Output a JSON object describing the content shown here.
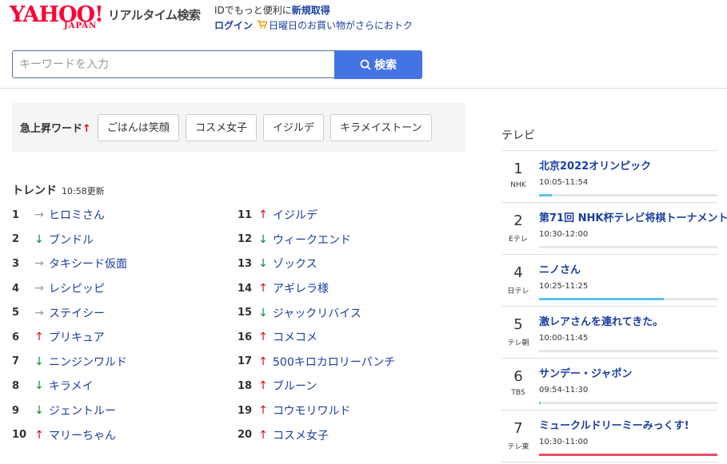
{
  "header": {
    "logo_text": "YAHOO!",
    "logo_sub": "JAPAN",
    "service_name": "リアルタイム検索",
    "promo_prefix": "IDでもっと便利に",
    "promo_link": "新規取得",
    "login_label": "ログイン",
    "shopping_text": "日曜日のお買い物がさらにおトク"
  },
  "search": {
    "placeholder": "キーワードを入力",
    "button_label": "検索"
  },
  "rising": {
    "label": "急上昇ワード",
    "words": [
      "ごはんは笑顔",
      "コスメ女子",
      "イジルデ",
      "キラメイストーン"
    ]
  },
  "trend": {
    "title": "トレンド",
    "updated": "10:58更新",
    "items": [
      {
        "rank": "1",
        "dir": "same",
        "word": "ヒロミさん"
      },
      {
        "rank": "2",
        "dir": "down",
        "word": "ブンドル"
      },
      {
        "rank": "3",
        "dir": "same",
        "word": "タキシード仮面"
      },
      {
        "rank": "4",
        "dir": "same",
        "word": "レシピッピ"
      },
      {
        "rank": "5",
        "dir": "same",
        "word": "ステイシー"
      },
      {
        "rank": "6",
        "dir": "up",
        "word": "プリキュア"
      },
      {
        "rank": "7",
        "dir": "down",
        "word": "ニンジンワルド"
      },
      {
        "rank": "8",
        "dir": "down",
        "word": "キラメイ"
      },
      {
        "rank": "9",
        "dir": "down",
        "word": "ジェントルー"
      },
      {
        "rank": "10",
        "dir": "up",
        "word": "マリーちゃん"
      },
      {
        "rank": "11",
        "dir": "up",
        "word": "イジルデ"
      },
      {
        "rank": "12",
        "dir": "down",
        "word": "ウィークエンド"
      },
      {
        "rank": "13",
        "dir": "down",
        "word": "ゾックス"
      },
      {
        "rank": "14",
        "dir": "up",
        "word": "アギレラ様"
      },
      {
        "rank": "15",
        "dir": "down",
        "word": "ジャックリバイス"
      },
      {
        "rank": "16",
        "dir": "up",
        "word": "コメコメ"
      },
      {
        "rank": "17",
        "dir": "up",
        "word": "500キロカロリーパンチ"
      },
      {
        "rank": "18",
        "dir": "up",
        "word": "ブルーン"
      },
      {
        "rank": "19",
        "dir": "up",
        "word": "コウモリワルド"
      },
      {
        "rank": "20",
        "dir": "up",
        "word": "コスメ女子"
      }
    ]
  },
  "tv": {
    "title": "テレビ",
    "items": [
      {
        "num": "1",
        "station": "NHK",
        "program": "北京2022オリンピック",
        "time": "10:05-11:54",
        "progress": 0.07,
        "bar_color": "#5ac3ee"
      },
      {
        "num": "2",
        "station": "Eテレ",
        "program": "第71回 NHK杯テレビ将棋トーナメント",
        "time": "10:30-12:00",
        "progress": 0.0,
        "bar_color": "#5ac3ee"
      },
      {
        "num": "4",
        "station": "日テレ",
        "program": "ニノさん",
        "time": "10:25-11:25",
        "progress": 0.7,
        "bar_color": "#5ac3ee"
      },
      {
        "num": "5",
        "station": "テレ朝",
        "program": "激レアさんを連れてきた。",
        "time": "10:00-11:45",
        "progress": 0.0,
        "bar_color": "#5ac3ee"
      },
      {
        "num": "6",
        "station": "TBS",
        "program": "サンデー・ジャポン",
        "time": "09:54-11:30",
        "progress": 0.01,
        "bar_color": "#5ac3ee"
      },
      {
        "num": "7",
        "station": "テレ東",
        "program": "ミュークルドリーミーみっくす!",
        "time": "10:30-11:00",
        "progress": 1.0,
        "bar_color": "#ea4e60"
      }
    ]
  }
}
